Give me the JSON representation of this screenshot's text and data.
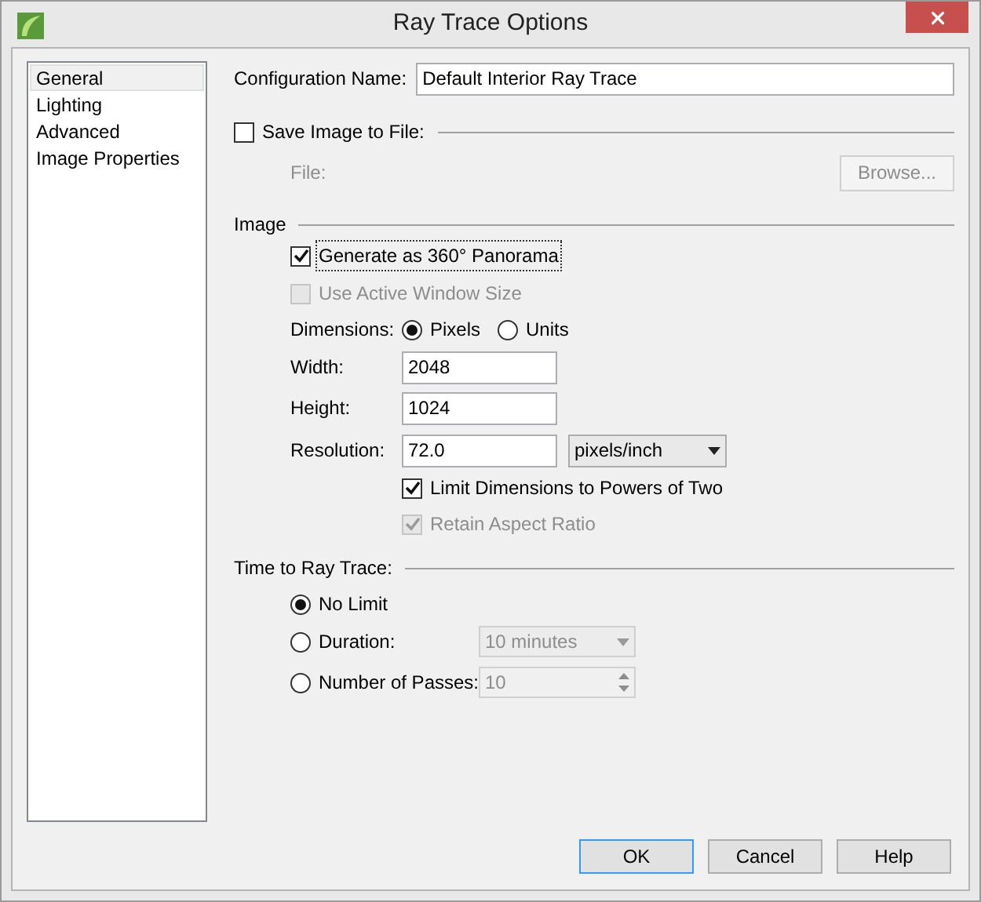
{
  "window": {
    "title": "Ray Trace Options"
  },
  "sidebar": {
    "items": [
      {
        "label": "General",
        "selected": true
      },
      {
        "label": "Lighting",
        "selected": false
      },
      {
        "label": "Advanced",
        "selected": false
      },
      {
        "label": "Image Properties",
        "selected": false
      }
    ]
  },
  "configuration_name": {
    "label": "Configuration Name:",
    "value": "Default Interior Ray Trace"
  },
  "save_image": {
    "label": "Save Image to File:",
    "checked": false
  },
  "file": {
    "label": "File:",
    "disabled": true,
    "button": "Browse..."
  },
  "image": {
    "heading": "Image",
    "panorama": {
      "label": "Generate as 360° Panorama",
      "checked": true,
      "disabled": false,
      "focused": true
    },
    "active_window": {
      "label": "Use Active Window Size",
      "checked": false,
      "disabled": true
    },
    "dimensions": {
      "label": "Dimensions:",
      "options": [
        {
          "label": "Pixels",
          "selected": true
        },
        {
          "label": "Units",
          "selected": false
        }
      ]
    },
    "width": {
      "label": "Width:",
      "value": "2048"
    },
    "height": {
      "label": "Height:",
      "value": "1024"
    },
    "resolution": {
      "label": "Resolution:",
      "value": "72.0",
      "unit": "pixels/inch"
    },
    "limit_powers": {
      "label": "Limit Dimensions to Powers of Two",
      "checked": true,
      "disabled": false,
      "focused": false
    },
    "aspect_ratio": {
      "label": "Retain Aspect Ratio",
      "checked": true,
      "disabled": true
    }
  },
  "time": {
    "heading": "Time to Ray Trace:",
    "options": [
      {
        "kind": "plain",
        "label": "No Limit",
        "selected": true
      },
      {
        "kind": "dropdown",
        "label": "Duration:",
        "selected": false,
        "value": "10 minutes",
        "disabled": true
      },
      {
        "kind": "spinner",
        "label": "Number of Passes:",
        "selected": false,
        "value": "10",
        "disabled": true
      }
    ]
  },
  "buttons": [
    {
      "label": "OK",
      "default": true
    },
    {
      "label": "Cancel",
      "default": false
    },
    {
      "label": "Help",
      "default": false
    }
  ]
}
